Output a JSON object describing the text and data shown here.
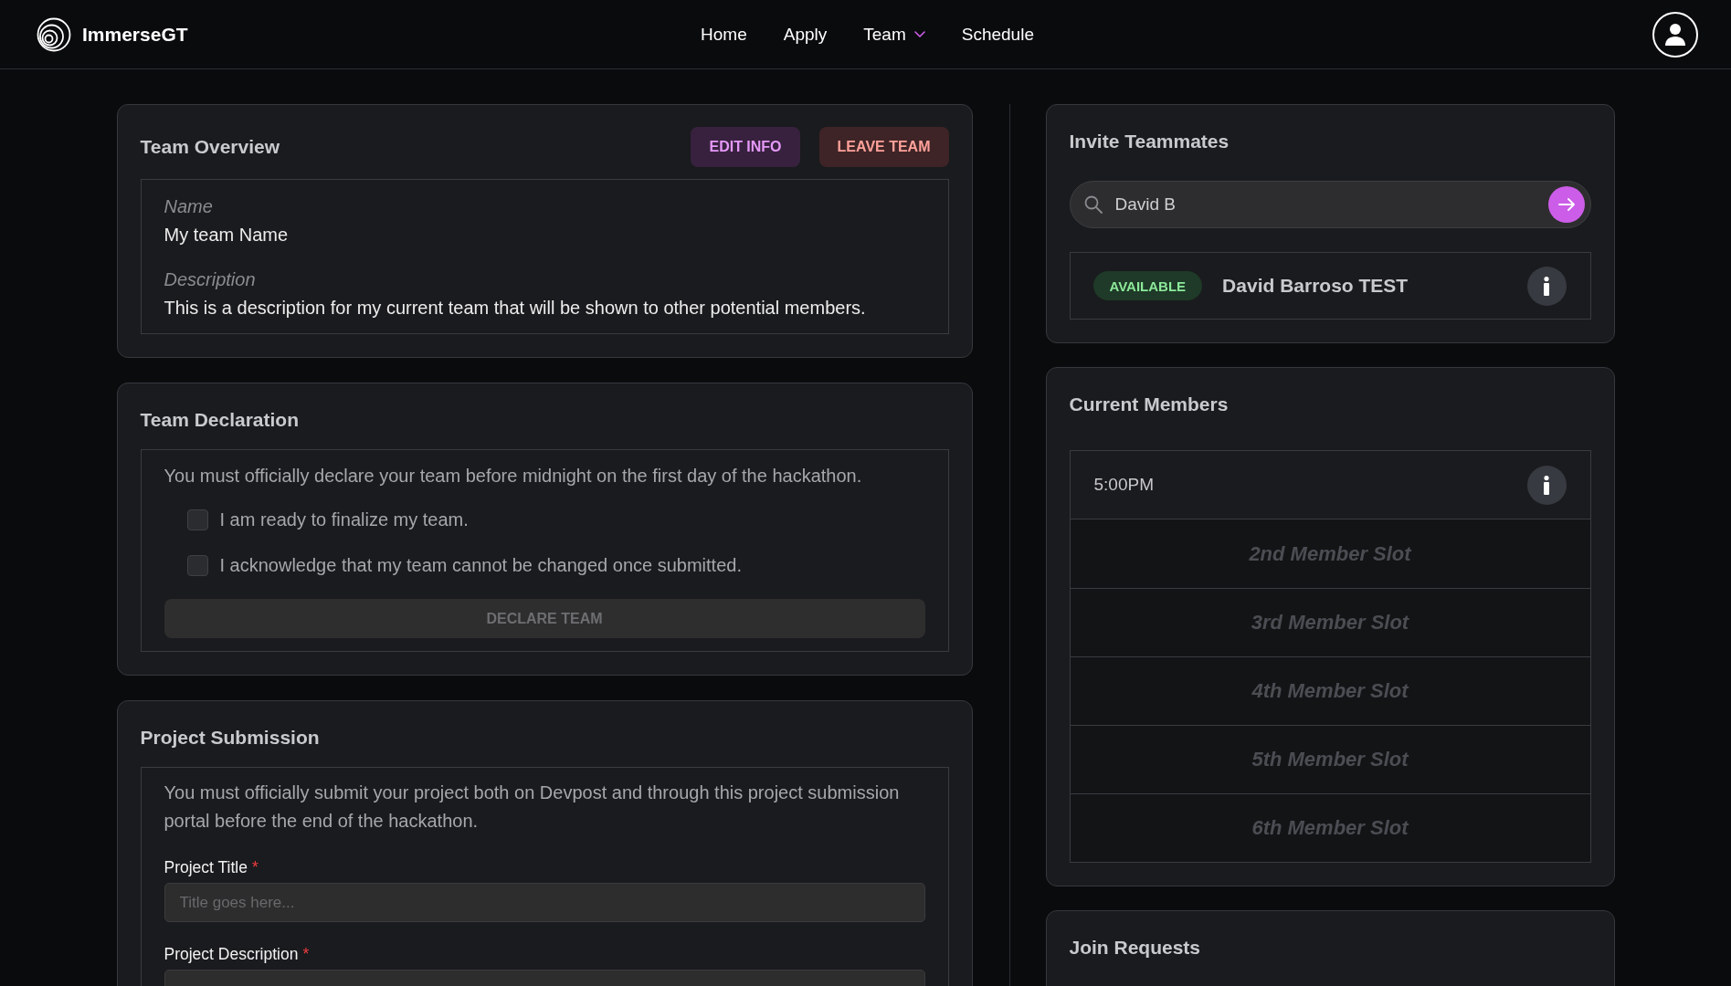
{
  "header": {
    "brand": "ImmerseGT",
    "nav": [
      {
        "label": "Home",
        "kind": "link"
      },
      {
        "label": "Apply",
        "kind": "link"
      },
      {
        "label": "Team",
        "kind": "dropdown"
      },
      {
        "label": "Schedule",
        "kind": "link"
      }
    ]
  },
  "team_overview": {
    "title": "Team Overview",
    "buttons": [
      {
        "label": "EDIT INFO",
        "kind": "edit"
      },
      {
        "label": "LEAVE TEAM",
        "kind": "leave"
      }
    ],
    "fields": [
      {
        "label": "Name",
        "value": "My team Name"
      },
      {
        "label": "Description",
        "value": "This is a description for my current team that will be shown to other potential members."
      }
    ]
  },
  "team_declaration": {
    "title": "Team Declaration",
    "notice": "You must officially declare your team before midnight on the first day of the hackathon.",
    "checkboxes": [
      {
        "label": "I am ready to finalize my team.",
        "checked": false
      },
      {
        "label": "I acknowledge that my team cannot be changed once submitted.",
        "checked": false
      }
    ],
    "button": {
      "label": "DECLARE TEAM",
      "disabled": true
    }
  },
  "project_submission": {
    "title": "Project Submission",
    "notice": "You must officially submit your project both on Devpost and through this project submission portal before the end of the hackathon.",
    "fields": [
      {
        "label": "Project Title",
        "required_mark": "*",
        "placeholder": "Title goes here..."
      },
      {
        "label": "Project Description",
        "required_mark": "*"
      }
    ]
  },
  "invite_teammates": {
    "title": "Invite Teammates",
    "search": {
      "value": "David B"
    },
    "results": [
      {
        "status": "AVAILABLE",
        "name": "David Barroso TEST"
      }
    ]
  },
  "current_members": {
    "title": "Current Members",
    "slots": [
      {
        "kind": "member",
        "text": "5:00PM"
      },
      {
        "kind": "empty",
        "text": "2nd Member Slot"
      },
      {
        "kind": "empty",
        "text": "3rd Member Slot"
      },
      {
        "kind": "empty",
        "text": "4th Member Slot"
      },
      {
        "kind": "empty",
        "text": "5th Member Slot"
      },
      {
        "kind": "empty",
        "text": "6th Member Slot"
      }
    ]
  },
  "join_requests": {
    "title": "Join Requests"
  }
}
